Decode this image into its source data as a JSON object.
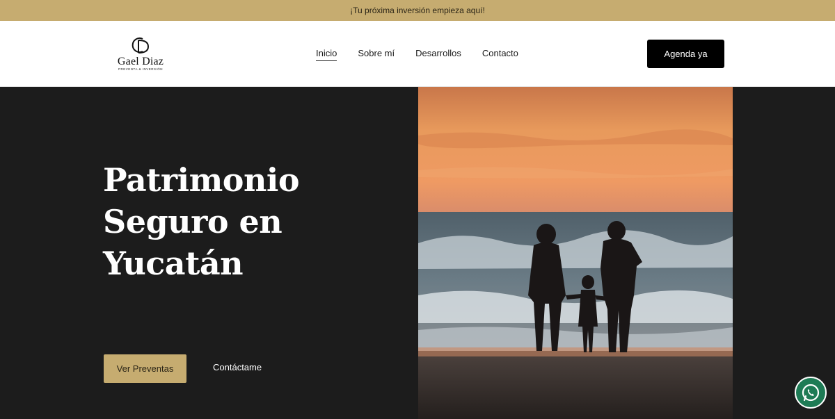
{
  "announcement": {
    "text": "¡Tu próxima inversión empieza aquí!"
  },
  "logo": {
    "monogram": "GD",
    "name": "Gael Diaz",
    "tagline": "PREVENTA & INVERSIÓN"
  },
  "nav": {
    "items": [
      {
        "label": "Inicio",
        "active": true
      },
      {
        "label": "Sobre mí",
        "active": false
      },
      {
        "label": "Desarrollos",
        "active": false
      },
      {
        "label": "Contacto",
        "active": false
      }
    ],
    "cta_label": "Agenda ya"
  },
  "hero": {
    "title": "Patrimonio Seguro en Yucatán",
    "primary_button": "Ver Preventas",
    "secondary_link": "Contáctame",
    "image_icon": "beach-family-sunset-photo"
  },
  "floating": {
    "icon": "whatsapp-icon"
  },
  "colors": {
    "gold": "#c6ac70",
    "dark": "#1c1c1c",
    "black": "#000000",
    "whatsapp": "#1e7b55"
  }
}
